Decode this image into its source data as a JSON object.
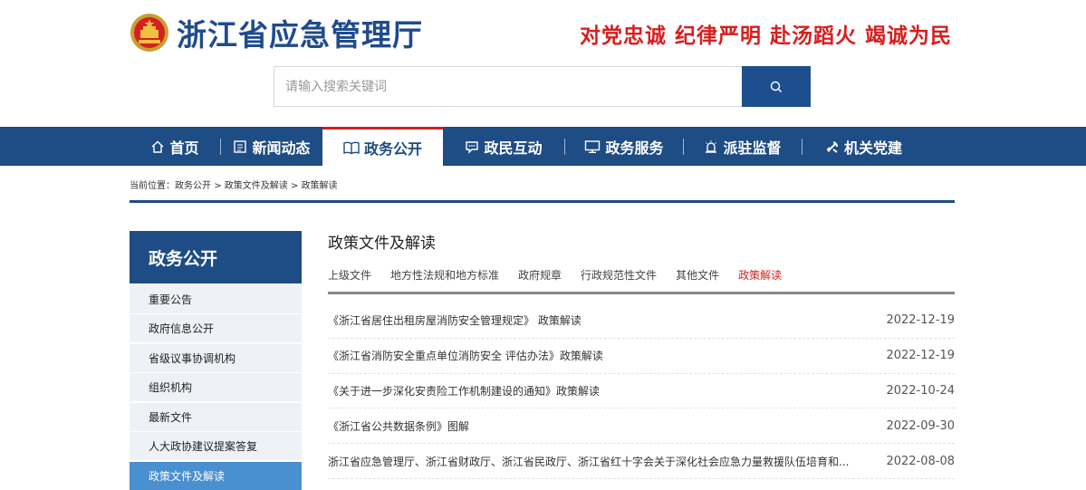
{
  "header": {
    "site_title": "浙江省应急管理厅",
    "slogan": "对党忠诚 纪律严明 赴汤蹈火 竭诚为民",
    "emblem_icon": "national-emblem-icon"
  },
  "search": {
    "placeholder": "请输入搜索关键词",
    "button_icon": "search-icon"
  },
  "nav": {
    "items": [
      {
        "label": "首页",
        "icon": "home-icon"
      },
      {
        "label": "新闻动态",
        "icon": "newspaper-icon"
      },
      {
        "label": "政务公开",
        "icon": "book-icon"
      },
      {
        "label": "政民互动",
        "icon": "chat-icon"
      },
      {
        "label": "政务服务",
        "icon": "monitor-icon"
      },
      {
        "label": "派驻监督",
        "icon": "alarm-icon"
      },
      {
        "label": "机关党建",
        "icon": "party-icon"
      }
    ],
    "active": "政务公开"
  },
  "breadcrumb": {
    "prefix": "当前位置：",
    "items": [
      "政务公开",
      "政策文件及解读",
      "政策解读"
    ],
    "separator": ">"
  },
  "sidebar": {
    "title": "政务公开",
    "items": [
      "重要公告",
      "政府信息公开",
      "省级议事协调机构",
      "组织机构",
      "最新文件",
      "人大政协建议提案答复",
      "政策文件及解读"
    ],
    "active": "政策文件及解读"
  },
  "main": {
    "title": "政策文件及解读",
    "tabs": [
      "上级文件",
      "地方性法规和地方标准",
      "政府规章",
      "行政规范性文件",
      "其他文件",
      "政策解读"
    ],
    "active_tab": "政策解读",
    "rows": [
      {
        "title": "《浙江省居住出租房屋消防安全管理规定》 政策解读",
        "date": "2022-12-19"
      },
      {
        "title": "《浙江省消防安全重点单位消防安全 评估办法》政策解读",
        "date": "2022-12-19"
      },
      {
        "title": "《关于进一步深化安责险工作机制建设的通知》政策解读",
        "date": "2022-10-24"
      },
      {
        "title": "《浙江省公共数据条例》图解",
        "date": "2022-09-30"
      },
      {
        "title": "浙江省应急管理厅、浙江省财政厅、浙江省民政厅、浙江省红十字会关于深化社会应急力量救援队伍培育和...",
        "date": "2022-08-08"
      }
    ]
  },
  "colors": {
    "primary": "#1e4c84",
    "accent_red": "#d81e1e",
    "sidebar_active": "#4a90d0"
  }
}
